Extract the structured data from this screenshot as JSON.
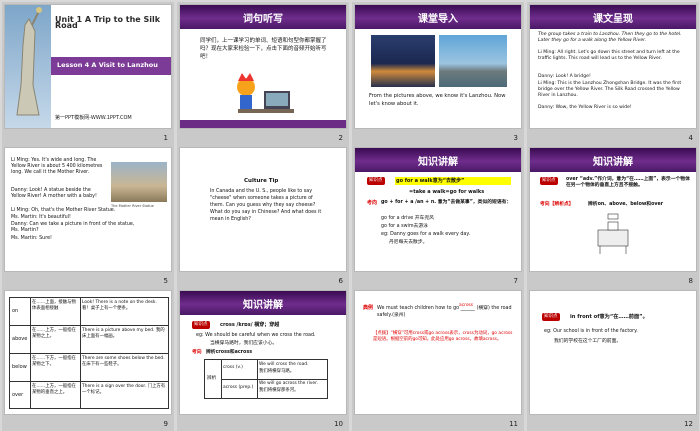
{
  "s1": {
    "num": "1",
    "unit": "Unit 1  A Trip to the Silk Road",
    "lesson": "Lesson 4  A Visit to Lanzhou",
    "footer": "第一PPT模板网-WWW.1PPT.COM"
  },
  "s2": {
    "num": "2",
    "title": "词句听写",
    "body": "同学们，上一课学习的单词、短语和句型你都掌握了吗？现在大家来检验一下，点击下面的音频开始听写吧！",
    "footer": "第一PPT模板网"
  },
  "s3": {
    "num": "3",
    "title": "课堂导入",
    "body": "From the pictures above, we know it's Lanzhou. Now let's know about it."
  },
  "s4": {
    "num": "4",
    "title": "课文呈现",
    "l1": "The group takes a train to Lanzhou. Then they go to the hotel. Later they go for a walk along the Yellow River.",
    "l2": "Li Ming:  All right. Let's go down this street and turn left at the traffic lights. This road will lead us to the Yellow River.",
    "l3": "Danny:  Look! A bridge!",
    "l4": "Li Ming:  This is the Lanzhou Zhongshan Bridge. It was the first bridge over the Yellow River. The Silk Road crossed the Yellow River in Lanzhou.",
    "l5": "Danny:  Wow, the Yellow River is so wide!"
  },
  "s5": {
    "num": "5",
    "l1": "Li Ming:  Yes. It's wide and long. The Yellow River is about 5 400 kilometres long. We call it the Mother River.",
    "l2": "Danny:  Look! A statue beside the Yellow River! A mother with a baby!",
    "l3": "Li Ming:  Oh, that's the Mother River Statue.",
    "l4": "Ms. Martin:  It's beautiful!",
    "l5": "Danny:  Can we take a picture in front of the statue, Ms. Martin?",
    "l6": "Ms. Martin:  Sure!",
    "cap": "The Mother River Statue"
  },
  "s6": {
    "num": "6",
    "head": "Culture Tip",
    "body": "In Canada and the U. S., people like to say \"cheese\" when someone takes a picture of them. Can you guess why they say cheese? What do you say in Chinese? And what does it mean in English?"
  },
  "s7": {
    "num": "7",
    "title": "知识讲解",
    "k1": "知识点",
    "b1": "go for a walk意为“去散步”",
    "b2": "=take a walk=go for walks",
    "k2": "考向",
    "b3": "go + for + a /an + n. 意为“去做某事”，类似的短语有：",
    "b4": "go for a drive 开车兜风",
    "b5": "go for a swim去游泳",
    "b6": "eg: Danny goes for a walk every day.",
    "b7": "丹尼每天去散步。"
  },
  "s8": {
    "num": "8",
    "title": "知识讲解",
    "k1": "知识点",
    "b1": "over “adv.”作介词，意为“在……上面”，表示一个物体在另一个物体的垂直上方且不接触。",
    "k2": "考向【辨析点】",
    "b2": "辨析on、above、below和over"
  },
  "s9": {
    "num": "9",
    "rows": [
      {
        "w": "on",
        "m": "在……上面，接触与物体表面相接触",
        "e": "Look! There is a note on the desk. 看！桌子上有一个便条。"
      },
      {
        "w": "above",
        "m": "在……上方，一般指在某物之上。",
        "e": "There is a picture above my bed. 我的床上面有一幅画。"
      },
      {
        "w": "below",
        "m": "在……下方，一般指在某物之下。",
        "e": "There are some shoes below the bed. 在床下有一些鞋子。"
      },
      {
        "w": "over",
        "m": "在……上方，一般指在某物的垂直之上。",
        "e": "There is a sign over the door. 门上方有一个标记。"
      }
    ]
  },
  "s10": {
    "num": "10",
    "title": "知识讲解",
    "k1": "知识点",
    "b1": "cross /krɒs/ 横穿；穿越",
    "b2": "eg: We should be careful  when we cross the road.",
    "b3": "当横穿马路时，我们应该小心。",
    "k2": "考向",
    "b4": "辨析cross和across",
    "tw": "辨析",
    "r1a": "cross  (v.)",
    "r1b": "We will cross the road.",
    "r1c": "我们将横穿马路。",
    "r2a": "across  (prep.)",
    "r2b": "We will go across the river.",
    "r2c": "我们将横穿那条河。"
  },
  "s11": {
    "num": "11",
    "k": "典例",
    "b1": "We must teach children how to go ______ (横穿) the road safely.(泉州)",
    "ans": "across",
    "b2": "【点拨】“横穿”可用cross或go across表示，cross为动词，go across是短语。根据空前的go可知，此处应用go across，故填across。"
  },
  "s12": {
    "num": "12",
    "k1": "知识点",
    "b1": "in front of意为“在……前面”。",
    "b2": "eg: Our school is in front of the factory.",
    "b3": "我们的学校在这个工厂的前面。"
  },
  "colors": {
    "purple": "#6b2c86",
    "red": "#cc0000",
    "yellow": "#ffff00"
  }
}
